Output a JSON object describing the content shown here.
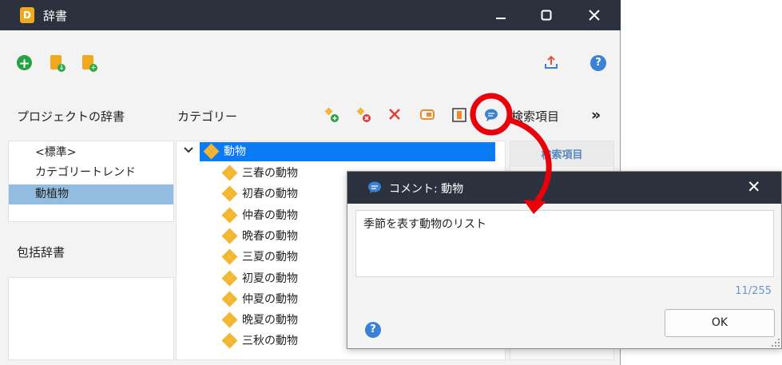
{
  "window": {
    "title": "辞書",
    "app_icon_letter": "D",
    "controls": [
      "minimize",
      "maximize",
      "close"
    ]
  },
  "toolbar": {
    "icons": [
      "add-icon",
      "import-dictionary-icon",
      "new-dictionary-icon",
      "export-icon",
      "help-icon"
    ]
  },
  "project_dict": {
    "label": "プロジェクトの辞書",
    "items": [
      {
        "label": "<標準>",
        "selected": false
      },
      {
        "label": "カテゴリートレンド",
        "selected": false
      },
      {
        "label": "動植物",
        "selected": true
      }
    ]
  },
  "inclusive_dict": {
    "label": "包括辞書"
  },
  "category": {
    "label": "カテゴリー",
    "toolbar_icons": [
      "add-category-icon",
      "remove-category-icon",
      "delete-icon",
      "rename-icon",
      "color-icon",
      "comment-icon"
    ],
    "overflow_symbol": "»",
    "collapse_symbol": "⌄",
    "root": "動物",
    "children": [
      "三春の動物",
      "初春の動物",
      "仲春の動物",
      "晩春の動物",
      "三夏の動物",
      "初夏の動物",
      "仲夏の動物",
      "晩夏の動物",
      "三秋の動物"
    ]
  },
  "search_items": {
    "label": "検索項目",
    "header": "検索項目"
  },
  "dialog": {
    "title": "コメント: 動物",
    "text": "季節を表す動物のリスト",
    "counter": "11/255",
    "ok_label": "OK",
    "close_symbol": "✕",
    "help_symbol": "?"
  },
  "colors": {
    "titlebar": "#2b323e",
    "selection": "#0a7af5",
    "list_selection": "#93bde0",
    "accent_blue": "#3b82d6",
    "callout_red": "#e8000b",
    "diamond": "#f3b630"
  }
}
